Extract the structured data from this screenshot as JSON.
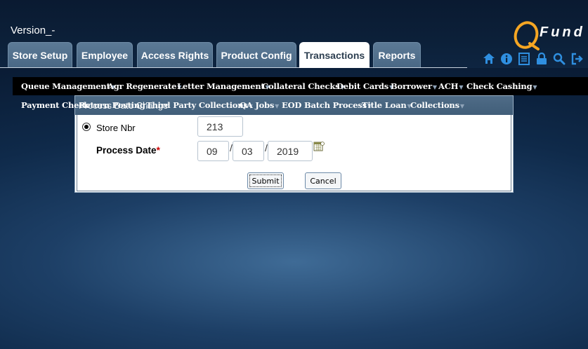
{
  "header": {
    "version": "Version_-",
    "logo_text": "Fund",
    "tabs": [
      {
        "label": "Store Setup",
        "active": false
      },
      {
        "label": "Employee",
        "active": false
      },
      {
        "label": "Access Rights",
        "active": false
      },
      {
        "label": "Product Config",
        "active": false
      },
      {
        "label": "Transactions",
        "active": true
      },
      {
        "label": "Reports",
        "active": false
      }
    ],
    "tool_icons": [
      "home-icon",
      "info-icon",
      "document-icon",
      "lock-icon",
      "search-icon",
      "logout-icon"
    ]
  },
  "menu": {
    "row1": [
      "Queue Management",
      "Agr Regenerate",
      "Letter Management",
      "Collateral Checks",
      "Debit Cards",
      "Borrower",
      "ACH",
      "Check Cashing"
    ],
    "row2": [
      "Payment Check",
      "Return Posting",
      "Third Party Collections",
      "QA Jobs",
      "EOD Batch Process",
      "Title Loan",
      "Collections"
    ]
  },
  "dialog": {
    "title": "Process Date Change",
    "store_label": "Store Nbr",
    "store_value": "213",
    "process_date_label": "Process Date",
    "required_mark": "*",
    "date_month": "09",
    "date_day": "03",
    "date_year": "2019",
    "date_sep": "/",
    "submit_label": "Submit",
    "cancel_label": "Cancel"
  },
  "colors": {
    "tab_bg": "#4a6885",
    "menu_bg": "#000000",
    "dialog_title_bg": "#4f6c87",
    "logo_accent": "#f5a623",
    "required": "#cc0000"
  }
}
